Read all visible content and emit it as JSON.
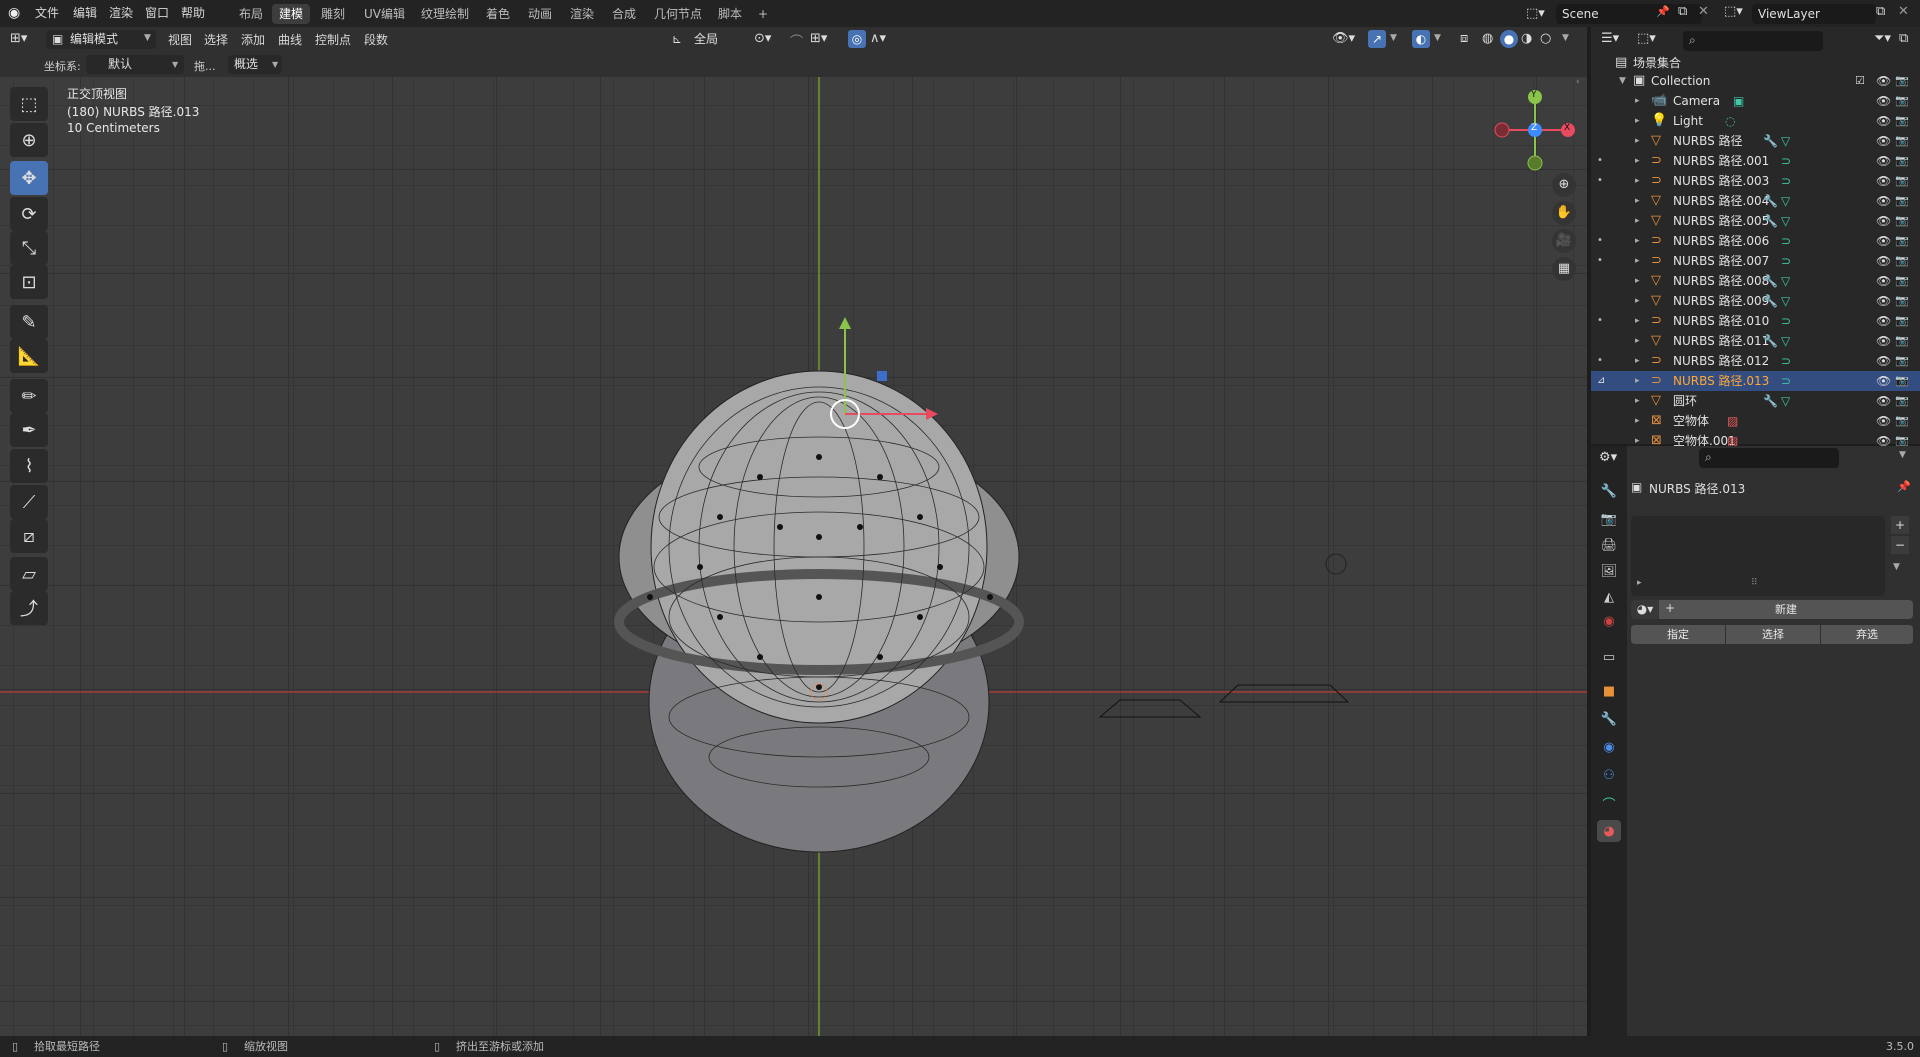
{
  "topbar": {
    "menus": [
      "文件",
      "编辑",
      "渲染",
      "窗口",
      "帮助"
    ],
    "workspaces": [
      "布局",
      "建模",
      "雕刻",
      "UV编辑",
      "纹理绘制",
      "着色",
      "动画",
      "渲染",
      "合成",
      "几何节点",
      "脚本",
      "+"
    ],
    "active_workspace": "建模",
    "scene": "Scene",
    "viewlayer": "ViewLayer"
  },
  "header": {
    "mode": "编辑模式",
    "menus": [
      "视图",
      "选择",
      "添加",
      "曲线",
      "控制点",
      "段数"
    ],
    "transform_orientation": "全局"
  },
  "tool_settings": {
    "coord_label": "坐标系:",
    "coord_value": "默认",
    "drag_label": "拖...",
    "select_value": "概选"
  },
  "viewport": {
    "view_name": "正交顶视图",
    "object_info": "(180) NURBS 路径.013",
    "scale": "10 Centimeters",
    "axes": {
      "x": "X",
      "y": "Y",
      "z": "Z"
    }
  },
  "outliner": {
    "root": "场景集合",
    "collection": "Collection",
    "items": [
      {
        "name": "Camera",
        "icon": "camera-icon",
        "color": "#e8913b"
      },
      {
        "name": "Light",
        "icon": "light-icon",
        "color": "#e8913b"
      },
      {
        "name": "NURBS 路径",
        "icon": "mesh-icon",
        "color": "#e8913b"
      },
      {
        "name": "NURBS 路径.001",
        "icon": "curve-icon",
        "color": "#e8913b"
      },
      {
        "name": "NURBS 路径.003",
        "icon": "curve-icon",
        "color": "#e8913b"
      },
      {
        "name": "NURBS 路径.004",
        "icon": "mesh-icon",
        "color": "#e8913b"
      },
      {
        "name": "NURBS 路径.005",
        "icon": "mesh-icon",
        "color": "#e8913b"
      },
      {
        "name": "NURBS 路径.006",
        "icon": "curve-icon",
        "color": "#e8913b"
      },
      {
        "name": "NURBS 路径.007",
        "icon": "curve-icon",
        "color": "#e8913b"
      },
      {
        "name": "NURBS 路径.008",
        "icon": "mesh-icon",
        "color": "#e8913b"
      },
      {
        "name": "NURBS 路径.009",
        "icon": "mesh-icon",
        "color": "#e8913b"
      },
      {
        "name": "NURBS 路径.010",
        "icon": "curve-icon",
        "color": "#e8913b"
      },
      {
        "name": "NURBS 路径.011",
        "icon": "mesh-icon",
        "color": "#e8913b"
      },
      {
        "name": "NURBS 路径.012",
        "icon": "curve-icon",
        "color": "#e8913b"
      },
      {
        "name": "NURBS 路径.013",
        "icon": "curve-icon",
        "color": "#e8913b"
      },
      {
        "name": "圆环",
        "icon": "mesh-icon",
        "color": "#e8913b"
      },
      {
        "name": "空物体",
        "icon": "empty-icon",
        "color": "#e8913b"
      },
      {
        "name": "空物体.001",
        "icon": "empty-icon",
        "color": "#e8913b"
      }
    ],
    "selected_index": 14
  },
  "properties": {
    "object_name": "NURBS 路径.013",
    "new_label": "新建",
    "assign_label": "指定",
    "select_label": "选择",
    "deselect_label": "弃选"
  },
  "status": {
    "left": "拾取最短路径",
    "middle": "缩放视图",
    "right": "挤出至游标或添加",
    "version": "3.5.0"
  },
  "colors": {
    "accent": "#4772b3",
    "selected": "#334d80",
    "orange": "#ffa834",
    "teal": "#3fc9a6"
  }
}
